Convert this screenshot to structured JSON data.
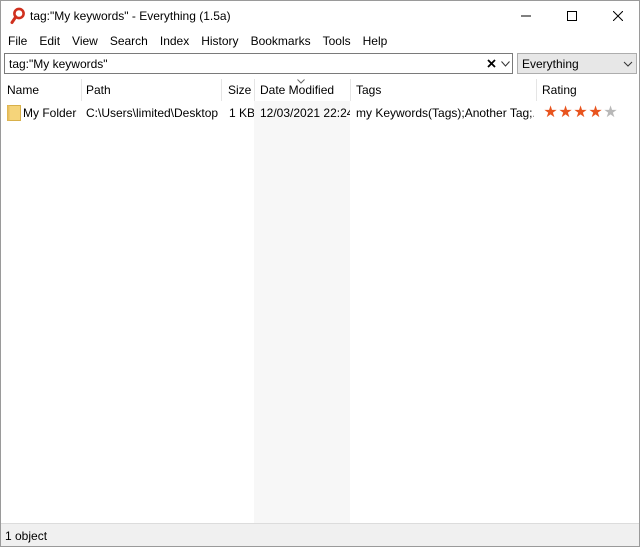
{
  "window": {
    "title": "tag:\"My keywords\" - Everything (1.5a)"
  },
  "menu": {
    "items": [
      "File",
      "Edit",
      "View",
      "Search",
      "Index",
      "History",
      "Bookmarks",
      "Tools",
      "Help"
    ]
  },
  "search": {
    "value": "tag:\"My keywords\"",
    "clear_icon": "close-icon",
    "history_icon": "chevron-down-icon"
  },
  "filter": {
    "selected": "Everything"
  },
  "columns": {
    "name": "Name",
    "path": "Path",
    "size": "Size",
    "date_modified": "Date Modified",
    "tags": "Tags",
    "rating": "Rating",
    "sorted_by": "Date Modified"
  },
  "rows": [
    {
      "name": "My Folder",
      "path": "C:\\Users\\limited\\Desktop",
      "size": "1 KB",
      "date_modified": "12/03/2021 22:24",
      "tags": "my Keywords(Tags);Another Tag;...",
      "rating": 4,
      "rating_max": 5,
      "icon": "folder-icon"
    }
  ],
  "status": {
    "text": "1 object"
  },
  "colors": {
    "star_filled": "#e8541e",
    "star_empty": "#b8b8b8",
    "folder": "#f5d47a",
    "app_icon": "#d0301e"
  }
}
